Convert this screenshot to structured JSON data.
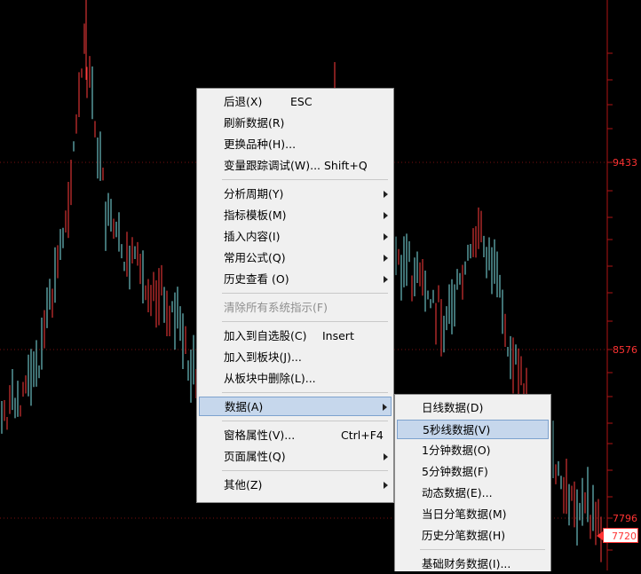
{
  "chart": {
    "axis_prices": [
      "9433",
      "8576",
      "7796"
    ],
    "last_price": "7720",
    "up_color": "#ff3b3b",
    "down_color": "#7fe3e8"
  },
  "context_menu": {
    "items": [
      {
        "label": "后退(X)",
        "shortcut": "ESC"
      },
      {
        "label": "刷新数据(R)"
      },
      {
        "label": "更换品种(H)..."
      },
      {
        "label": "变量跟踪调试(W)...",
        "shortcut": "Shift+Q"
      },
      {
        "label": "分析周期(Y)",
        "submenu": true
      },
      {
        "label": "指标模板(M)",
        "submenu": true
      },
      {
        "label": "插入内容(I)",
        "submenu": true
      },
      {
        "label": "常用公式(Q)",
        "submenu": true
      },
      {
        "label": "历史查看 (O)",
        "submenu": true
      },
      {
        "label": "清除所有系统指示(F)",
        "disabled": true
      },
      {
        "label": "加入到自选股(C)",
        "shortcut": "Insert"
      },
      {
        "label": "加入到板块(J)..."
      },
      {
        "label": "从板块中删除(L)..."
      },
      {
        "label": "数据(A)",
        "submenu": true,
        "highlighted": true
      },
      {
        "label": "窗格属性(V)...",
        "shortcut": "Ctrl+F4"
      },
      {
        "label": "页面属性(Q)",
        "submenu": true
      },
      {
        "label": "其他(Z)",
        "submenu": true
      }
    ]
  },
  "data_submenu": {
    "items": [
      {
        "label": "日线数据(D)"
      },
      {
        "label": "5秒线数据(V)",
        "highlighted": true
      },
      {
        "label": "1分钟数据(O)"
      },
      {
        "label": "5分钟数据(F)"
      },
      {
        "label": "动态数据(E)..."
      },
      {
        "label": "当日分笔数据(M)"
      },
      {
        "label": "历史分笔数据(H)"
      },
      {
        "label": "基础财务数据(I)..."
      }
    ]
  }
}
